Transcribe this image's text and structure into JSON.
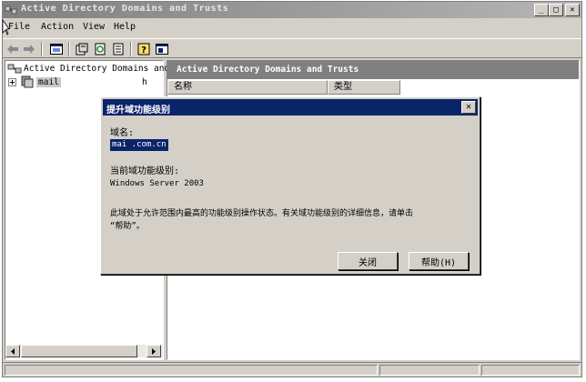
{
  "window": {
    "title": "Active Directory Domains and Trusts",
    "minimize": "_",
    "maximize": "□",
    "close": "✕"
  },
  "menu": {
    "file": "File",
    "action": "Action",
    "view": "View",
    "help": "Help"
  },
  "tree": {
    "root_label": "Active Directory Domains and",
    "domain_label": "mail",
    "domain_suffix": "h"
  },
  "right_pane": {
    "header": "Active Directory Domains and Trusts",
    "col_name": "名称",
    "col_type": "类型"
  },
  "dialog": {
    "title": "提升域功能级别",
    "close": "✕",
    "domain_label": "域名:",
    "domain_value": "mai            .com.cn",
    "current_level_label": "当前域功能级别:",
    "current_level_value": "Windows Server 2003",
    "info_line1": "此域处于允许范围内最高的功能级别操作状态。有关域功能级别的详细信息，请单击",
    "info_line2": "“帮助”。",
    "close_button": "关闭",
    "help_button": "帮助(H)"
  },
  "colors": {
    "face": "#d4d0c8",
    "active_title": "#0a246a",
    "inactive_title": "#808080"
  }
}
